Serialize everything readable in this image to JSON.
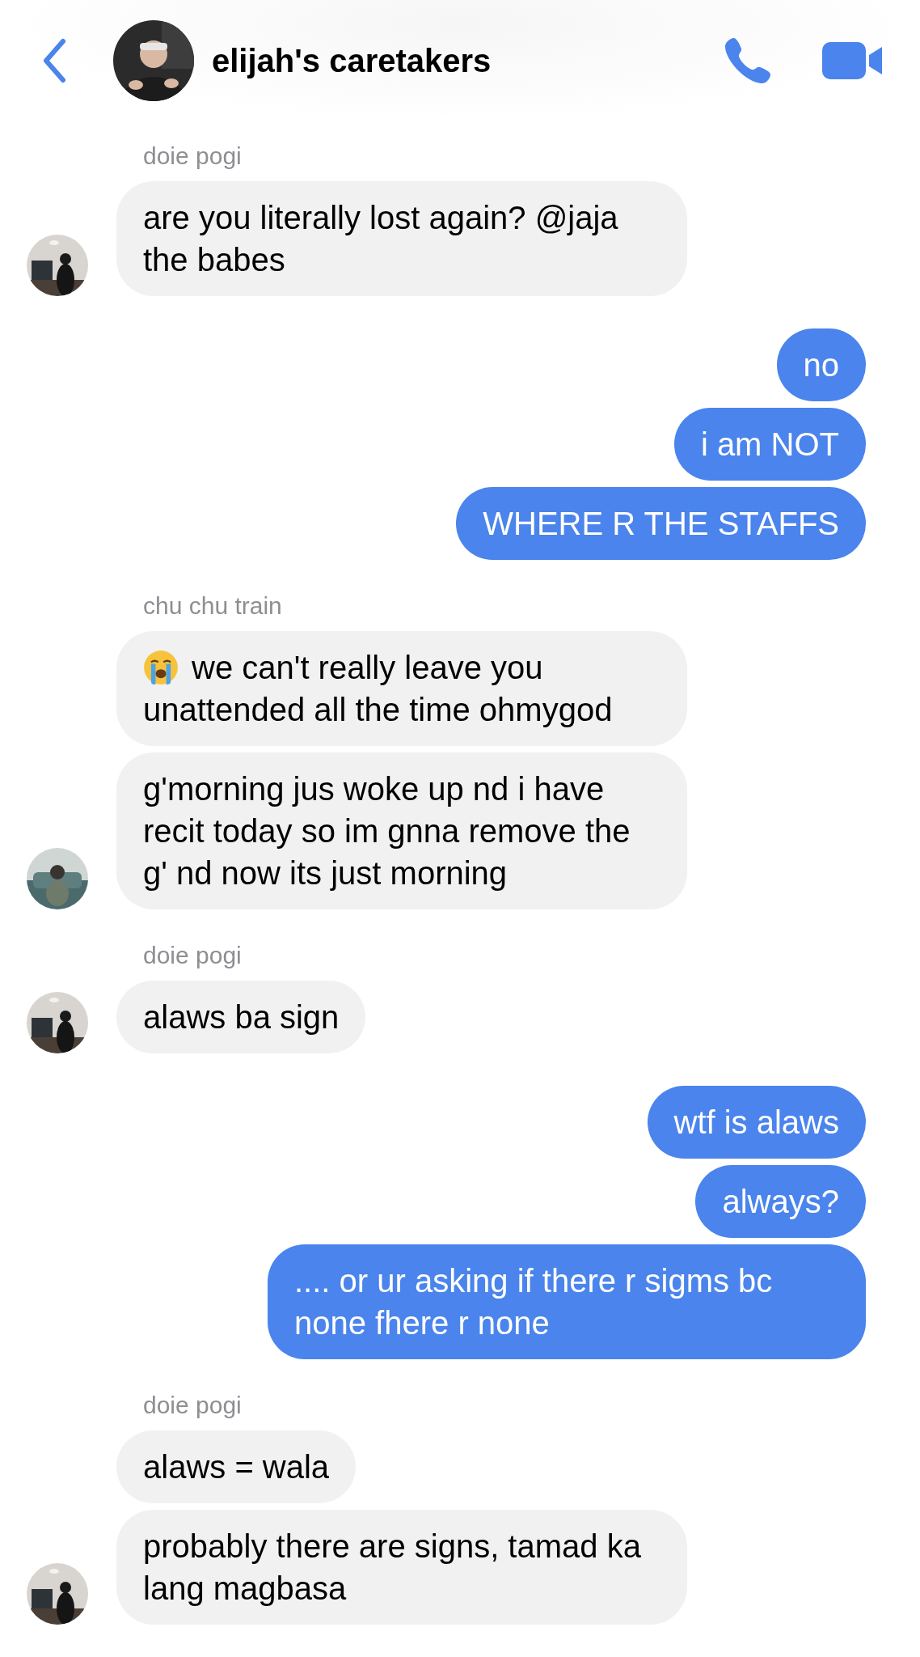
{
  "header": {
    "title": "elijah's caretakers"
  },
  "groups": [
    {
      "kind": "incoming",
      "sender": "doie pogi",
      "avatar": {
        "kind": "picture"
      },
      "messages": [
        {
          "kind": "text",
          "text": "are you literally lost again? @jaja the babes"
        }
      ]
    },
    {
      "kind": "outgoing",
      "messages": [
        {
          "kind": "text",
          "text": "no"
        },
        {
          "kind": "text",
          "text": "i am NOT"
        },
        {
          "kind": "text",
          "text": "WHERE R THE STAFFS"
        }
      ]
    },
    {
      "kind": "incoming",
      "sender": "chu chu train",
      "avatar": {
        "kind": "picture"
      },
      "messages": [
        {
          "kind": "crying-emoji",
          "text": "we can't really leave you unattended all the time ohmygod"
        },
        {
          "kind": "text",
          "text": "g'morning jus woke up nd i have recit today so im gnna remove the g' nd now its just morning"
        }
      ]
    },
    {
      "kind": "incoming",
      "sender": "doie pogi",
      "avatar": {
        "kind": "picture"
      },
      "messages": [
        {
          "kind": "text",
          "text": "alaws ba sign"
        }
      ]
    },
    {
      "kind": "outgoing",
      "messages": [
        {
          "kind": "text",
          "text": "wtf is alaws"
        },
        {
          "kind": "text",
          "text": "always?"
        },
        {
          "kind": "text",
          "text": ".... or ur asking if there r sigms bc none fhere r none"
        }
      ]
    },
    {
      "kind": "incoming",
      "sender": "doie pogi",
      "avatar": {
        "kind": "picture"
      },
      "messages": [
        {
          "kind": "text",
          "text": "alaws = wala"
        },
        {
          "kind": "text",
          "text": "probably there are signs, tamad ka lang magbasa"
        }
      ]
    }
  ]
}
